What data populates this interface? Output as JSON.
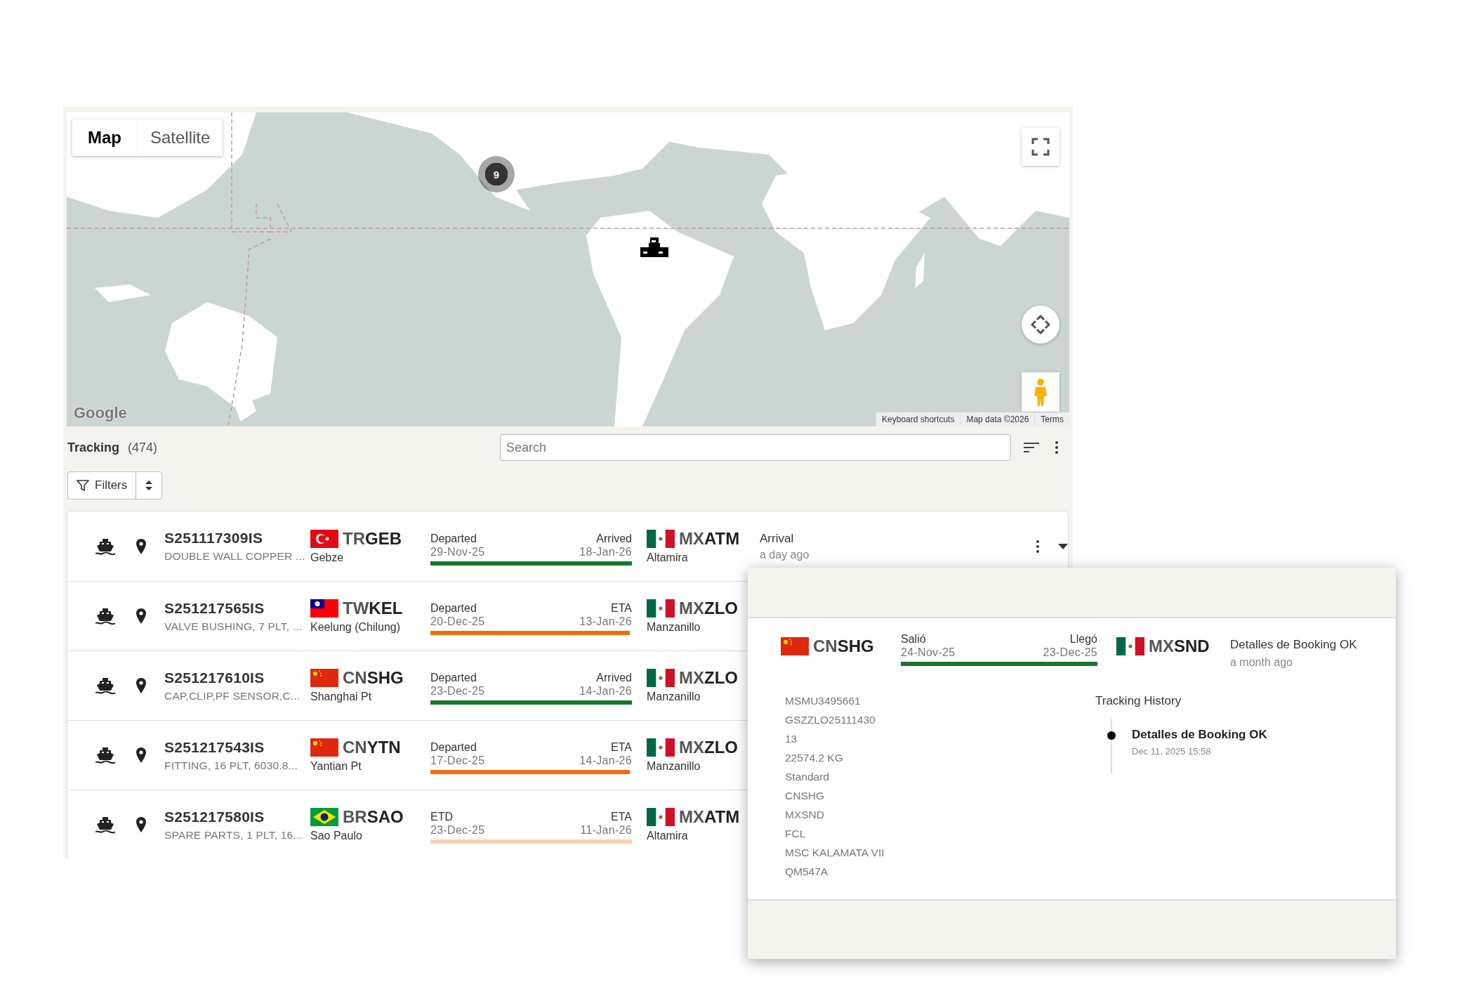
{
  "map": {
    "view_tabs": [
      {
        "label": "Map",
        "selected": true
      },
      {
        "label": "Satellite",
        "selected": false
      }
    ],
    "cluster": {
      "count": "9"
    },
    "logo": "Google",
    "attribution": [
      "Keyboard shortcuts",
      "Map data ©2026",
      "Terms"
    ]
  },
  "tracking": {
    "title": "Tracking",
    "count": "(474)",
    "search": {
      "placeholder": "Search"
    },
    "filters_button": "Filters"
  },
  "shipments": [
    {
      "id": "S251117309IS",
      "description": "DOUBLE WALL COPPER ...",
      "origin": {
        "kind": "tr",
        "country": "TR",
        "port": "GEB",
        "name": "Gebze"
      },
      "leg": {
        "start_label": "Departed",
        "start_date": "29-Nov-25",
        "end_label": "Arrived",
        "end_date": "18-Jan-26",
        "level": 1,
        "color": "#17762b"
      },
      "destination": {
        "kind": "mx",
        "country": "MX",
        "port": "ATM",
        "name": "Altamira"
      },
      "status": "Arrival",
      "status_time": "a day ago"
    },
    {
      "id": "S251217565IS",
      "description": "VALVE BUSHING, 7 PLT, ...",
      "origin": {
        "kind": "tw",
        "country": "TW",
        "port": "KEL",
        "name": "Keelung (Chilung)"
      },
      "leg": {
        "start_label": "Departed",
        "start_date": "20-Dec-25",
        "end_label": "ETA",
        "end_date": "13-Jan-26",
        "level": 0.99,
        "color": "#f26c0d"
      },
      "destination": {
        "kind": "mx",
        "country": "MX",
        "port": "ZLO",
        "name": "Manzanillo"
      }
    },
    {
      "id": "S251217610IS",
      "description": "CAP,CLIP,PF SENSOR,C...",
      "origin": {
        "kind": "cn",
        "country": "CN",
        "port": "SHG",
        "name": "Shanghai Pt"
      },
      "leg": {
        "start_label": "Departed",
        "start_date": "23-Dec-25",
        "end_label": "Arrived",
        "end_date": "14-Jan-26",
        "level": 1,
        "color": "#17762b"
      },
      "destination": {
        "kind": "mx",
        "country": "MX",
        "port": "ZLO",
        "name": "Manzanillo"
      }
    },
    {
      "id": "S251217543IS",
      "description": "FITTING, 16 PLT, 6030.8...",
      "origin": {
        "kind": "cn",
        "country": "CN",
        "port": "YTN",
        "name": "Yantian Pt"
      },
      "leg": {
        "start_label": "Departed",
        "start_date": "17-Dec-25",
        "end_label": "ETA",
        "end_date": "14-Jan-26",
        "level": 0.99,
        "color": "#f26c0d"
      },
      "destination": {
        "kind": "mx",
        "country": "MX",
        "port": "ZLO",
        "name": "Manzanillo"
      }
    },
    {
      "id": "S251217580IS",
      "description": "SPARE PARTS, 1 PLT, 16...",
      "origin": {
        "kind": "br",
        "country": "BR",
        "port": "SAO",
        "name": "Sao Paulo"
      },
      "leg": {
        "start_label": "ETD",
        "start_date": "23-Dec-25",
        "end_label": "ETA",
        "end_date": "11-Jan-26",
        "level": 1,
        "color": "#fbd1ae"
      },
      "destination": {
        "kind": "mx",
        "country": "MX",
        "port": "ATM",
        "name": "Altamira"
      }
    }
  ],
  "detail": {
    "origin": {
      "kind": "cn",
      "country": "CN",
      "port": "SHG"
    },
    "leg": {
      "start_label": "Salió",
      "start_date": "24-Nov-25",
      "end_label": "Llegó",
      "end_date": "23-Dec-25",
      "level": 1,
      "color": "#17762b"
    },
    "destination": {
      "kind": "mx",
      "country": "MX",
      "port": "SND"
    },
    "status": "Detalles de Booking OK",
    "status_time": "a month ago",
    "fields": [
      "MSMU3495661",
      "GSZZLO25111430",
      "13",
      "22574.2 KG",
      "Standard",
      "CNSHG",
      "MXSND",
      "FCL",
      "MSC KALAMATA VII",
      "QM547A"
    ],
    "history_title": "Tracking History",
    "history": [
      {
        "title": "Detalles de Booking OK",
        "time": "Dec 11, 2025 15:58"
      }
    ]
  }
}
